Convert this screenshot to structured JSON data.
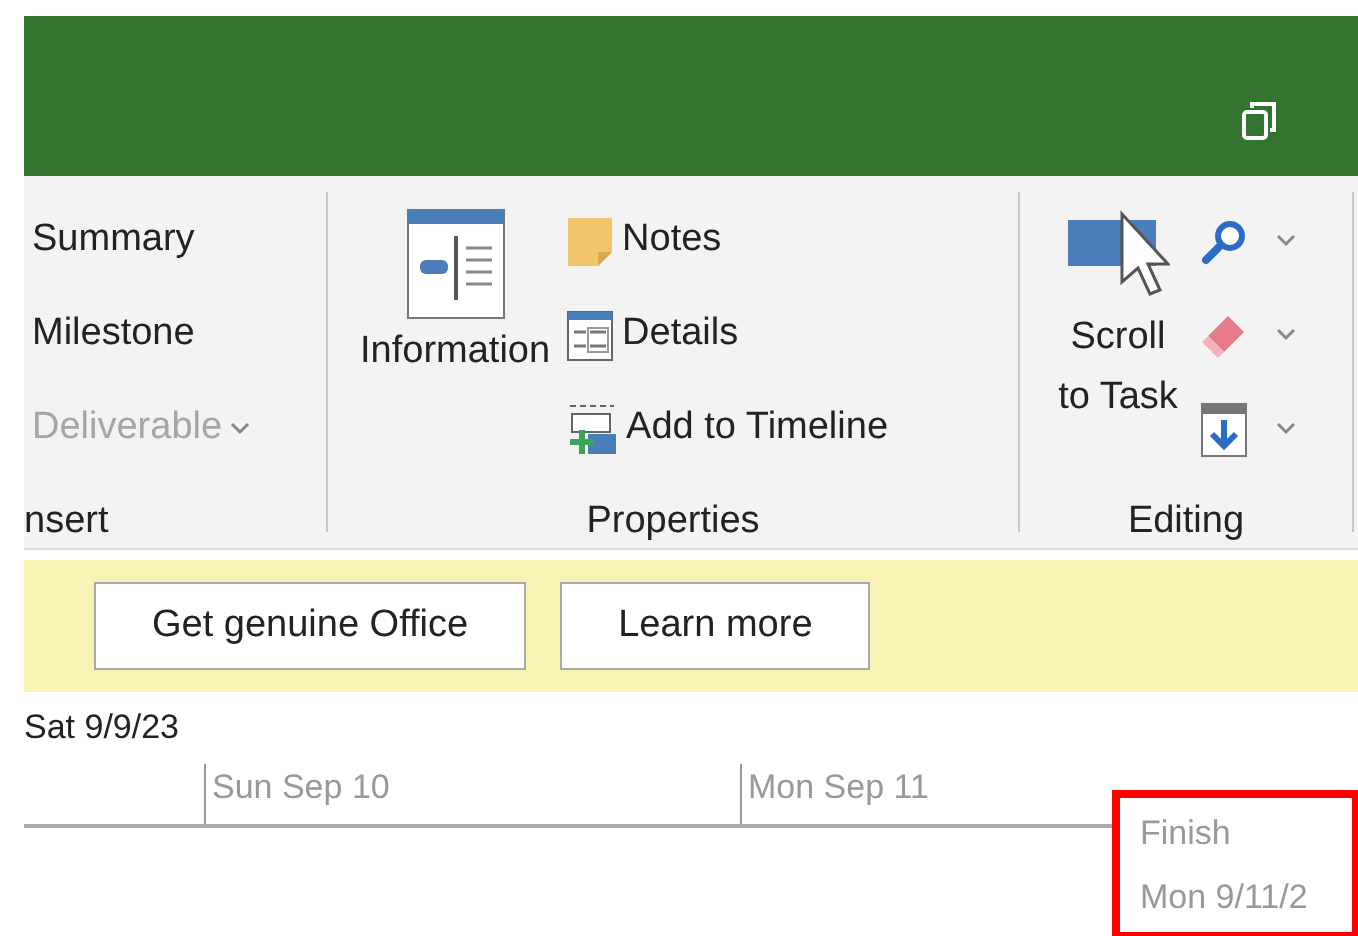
{
  "ribbon": {
    "groups": [
      {
        "label": "nsert",
        "items": [
          {
            "kind": "small",
            "label": "Summary",
            "disabled": false,
            "dropdown": false
          },
          {
            "kind": "small",
            "label": "Milestone",
            "disabled": false,
            "dropdown": false
          },
          {
            "kind": "small",
            "label": "Deliverable",
            "disabled": true,
            "dropdown": true
          }
        ]
      },
      {
        "label": "Properties",
        "items": [
          {
            "kind": "large",
            "label": "Information",
            "disabled": false,
            "dropdown": false
          },
          {
            "kind": "small",
            "label": "Notes",
            "disabled": false,
            "dropdown": false
          },
          {
            "kind": "small",
            "label": "Details",
            "disabled": false,
            "dropdown": false
          },
          {
            "kind": "small",
            "label": "Add to Timeline",
            "disabled": false,
            "dropdown": false
          }
        ]
      },
      {
        "label": "Editing",
        "items": [
          {
            "kind": "large",
            "label": "Scroll to Task",
            "disabled": false,
            "dropdown": false
          },
          {
            "kind": "icon",
            "disabled": false,
            "dropdown": true
          },
          {
            "kind": "icon",
            "disabled": false,
            "dropdown": true
          },
          {
            "kind": "icon",
            "disabled": false,
            "dropdown": true
          }
        ]
      }
    ]
  },
  "notice_bar": {
    "buttons": [
      "Get genuine Office",
      "Learn more"
    ]
  },
  "timeline": {
    "start_date": "Sat 9/9/23",
    "ticks": [
      "Sun Sep 10",
      "Mon Sep 11"
    ],
    "finish": {
      "label": "Finish",
      "date": "Mon 9/11/2",
      "highlighted": true
    }
  }
}
